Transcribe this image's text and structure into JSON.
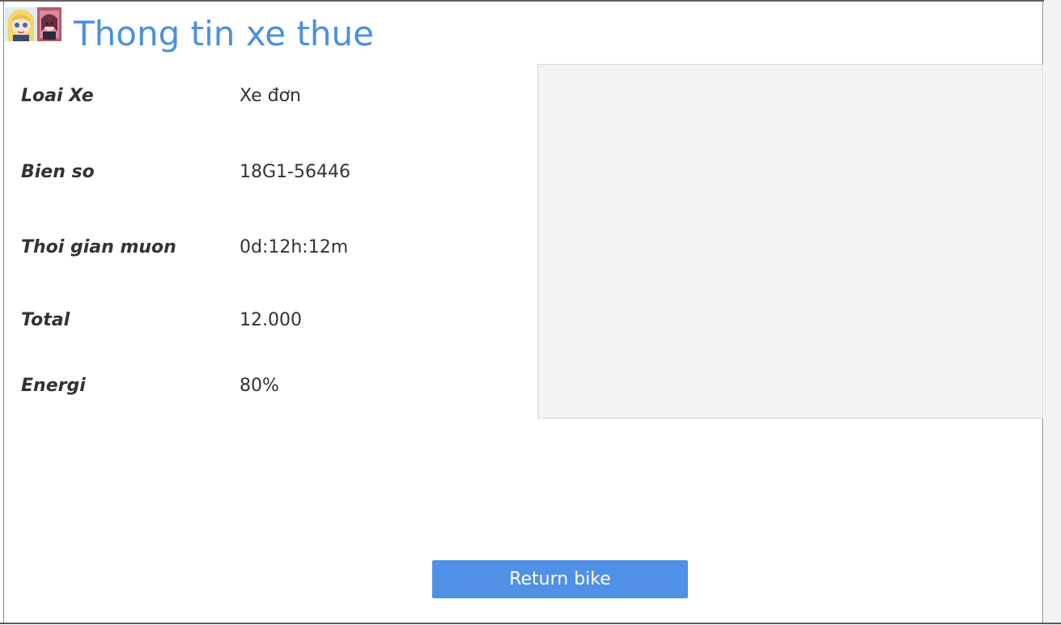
{
  "header": {
    "title": "Thong tin xe thue"
  },
  "details": {
    "bike_type": {
      "label": "Loai Xe",
      "value": "Xe đơn"
    },
    "plate": {
      "label": "Bien so",
      "value": "18G1-56446"
    },
    "rent_time": {
      "label": "Thoi gian muon",
      "value": "0d:12h:12m"
    },
    "total": {
      "label": "Total",
      "value": "12.000"
    },
    "energy": {
      "label": "Energi",
      "value": "80%"
    }
  },
  "actions": {
    "return_label": "Return bike"
  },
  "colors": {
    "accent": "#4a90e2",
    "button": "#5090e6",
    "text": "#333333",
    "image_placeholder": "#f3f3f3"
  }
}
